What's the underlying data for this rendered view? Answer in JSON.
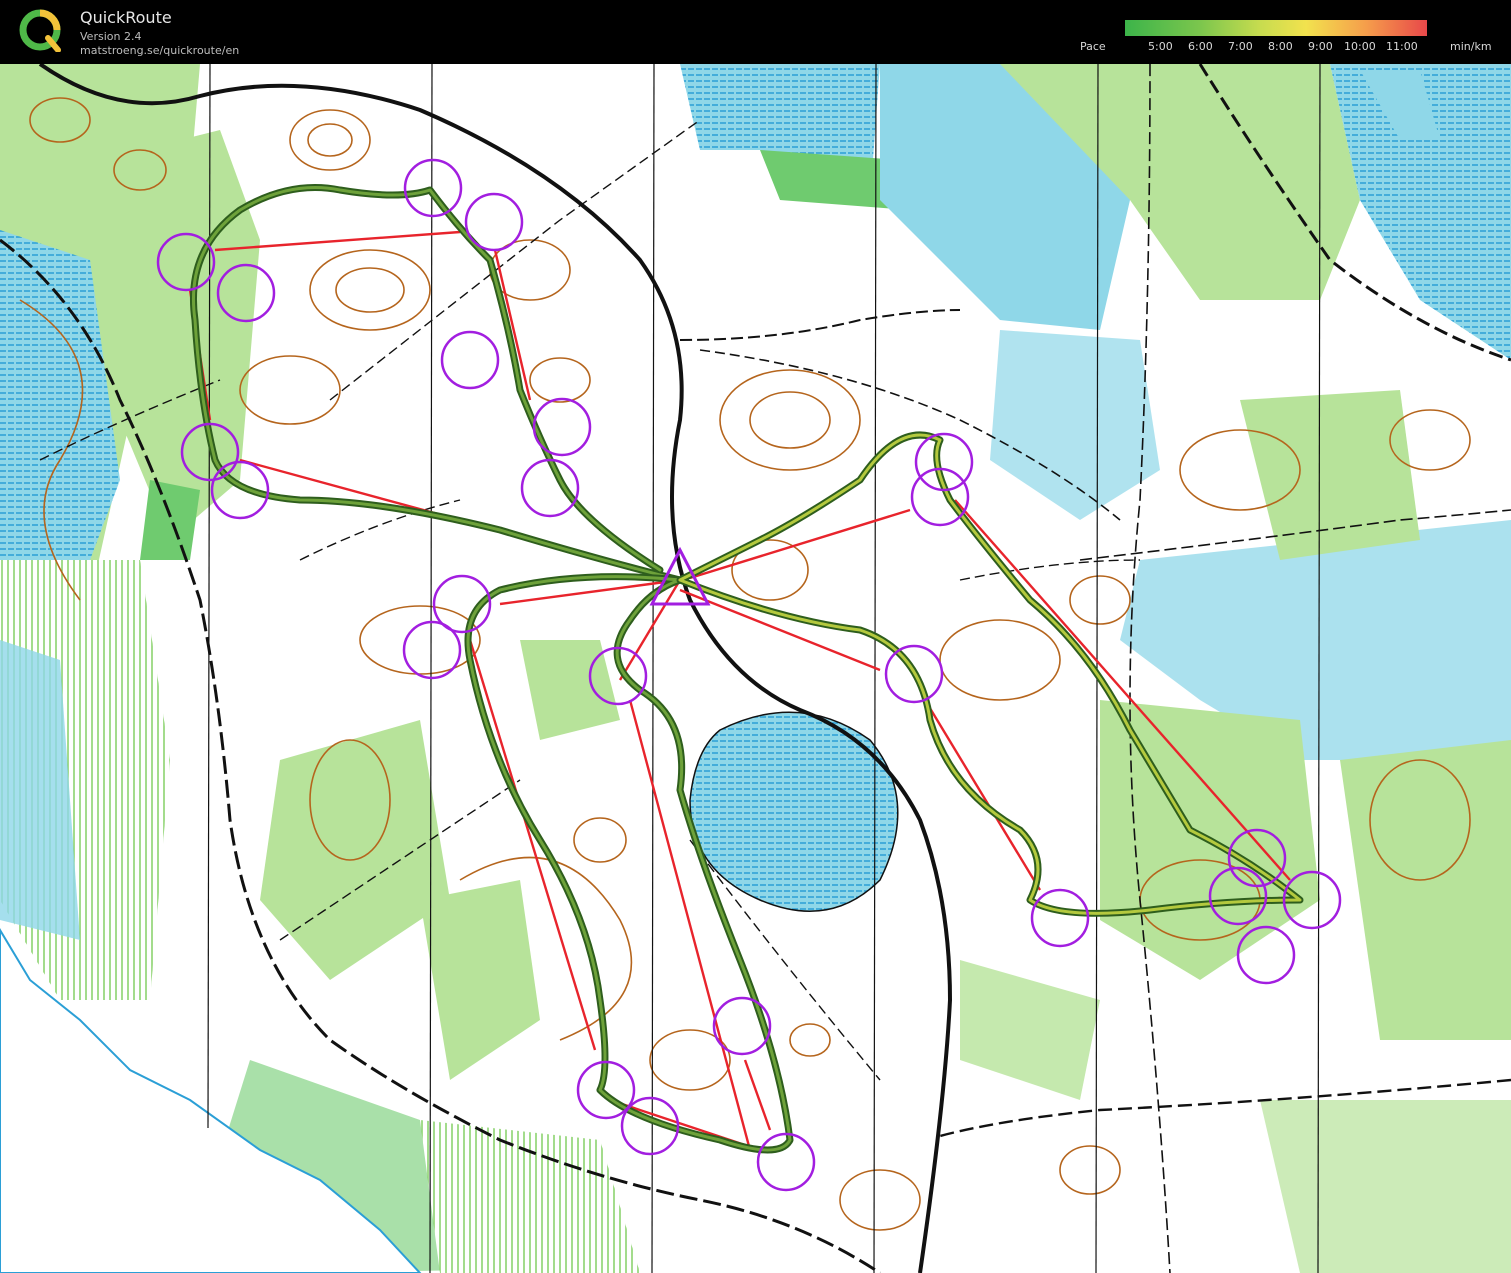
{
  "app": {
    "name": "QuickRoute",
    "version": "Version 2.4",
    "url": "matstroeng.se/quickroute/en"
  },
  "legend": {
    "label": "Pace",
    "ticks": [
      "5:00",
      "6:00",
      "7:00",
      "8:00",
      "9:00",
      "10:00",
      "11:00"
    ],
    "unit": "min/km",
    "colors": [
      "#3cb44a",
      "#7cc64d",
      "#c8dc4f",
      "#f2e24e",
      "#f59d4b",
      "#e8484a"
    ]
  },
  "map": {
    "colors": {
      "water": "#8fd7e8",
      "forest_slow": "#b7e39a",
      "forest_dense": "#6fcb6f",
      "marsh": "#2b9fd6",
      "contour": "#b5651d",
      "control": "#a21ee0",
      "course_line": "#e8242c",
      "route": "#3e7a2b",
      "road": "#111111"
    },
    "icons": [
      "start-triangle-icon",
      "control-circle-icon"
    ]
  }
}
